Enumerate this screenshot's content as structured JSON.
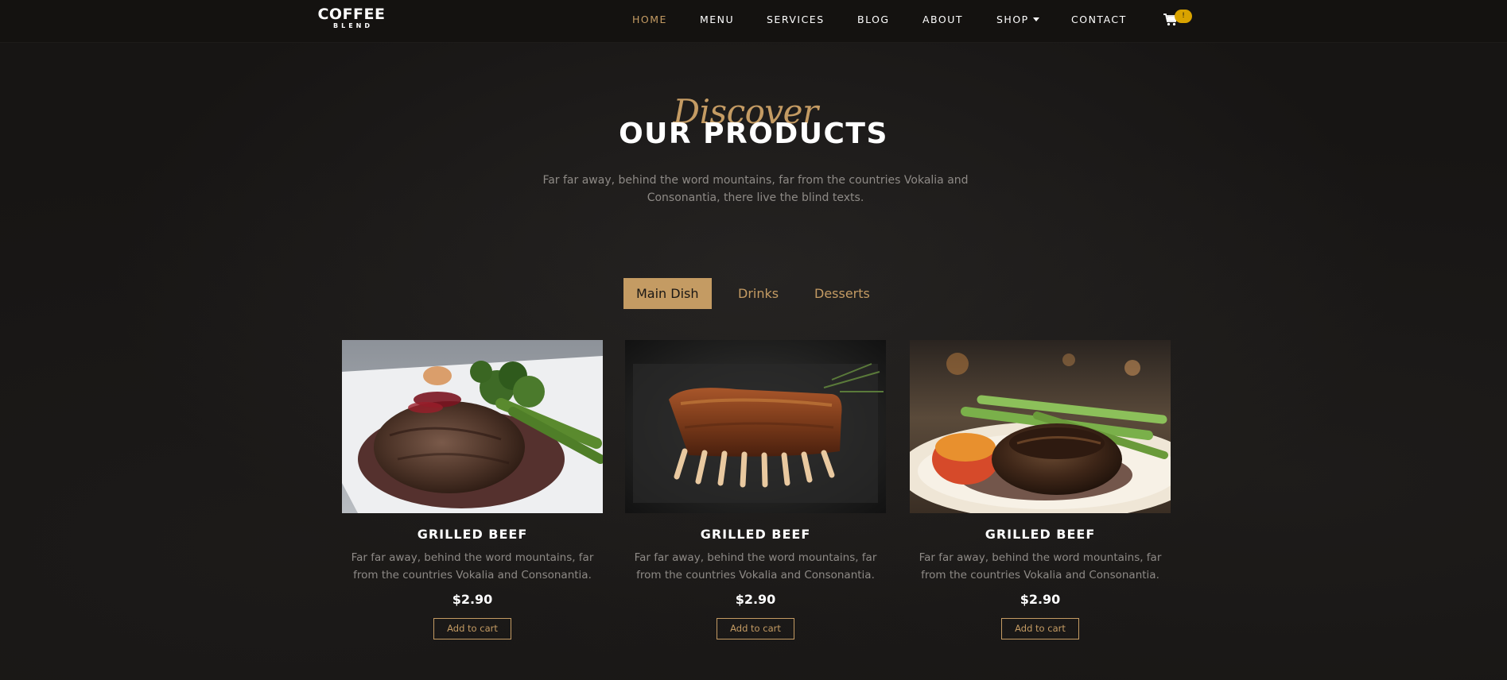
{
  "brand": {
    "main": "COFFEE",
    "sub": "BLEND"
  },
  "nav": {
    "items": [
      {
        "label": "HOME"
      },
      {
        "label": "MENU"
      },
      {
        "label": "SERVICES"
      },
      {
        "label": "BLOG"
      },
      {
        "label": "ABOUT"
      },
      {
        "label": "SHOP"
      },
      {
        "label": "CONTACT"
      }
    ],
    "cart_count": "!"
  },
  "heading": {
    "script": "Discover",
    "title": "OUR PRODUCTS",
    "intro": "Far far away, behind the word mountains, far from the countries Vokalia and Consonantia, there live the blind texts."
  },
  "tabs": [
    {
      "label": "Main Dish"
    },
    {
      "label": "Drinks"
    },
    {
      "label": "Desserts"
    }
  ],
  "products": [
    {
      "title": "GRILLED BEEF",
      "description": "Far far away, behind the word mountains, far from the countries Vokalia and Consonantia.",
      "price": "$2.90",
      "button": "Add to cart"
    },
    {
      "title": "GRILLED BEEF",
      "description": "Far far away, behind the word mountains, far from the countries Vokalia and Consonantia.",
      "price": "$2.90",
      "button": "Add to cart"
    },
    {
      "title": "GRILLED BEEF",
      "description": "Far far away, behind the word mountains, far from the countries Vokalia and Consonantia.",
      "price": "$2.90",
      "button": "Add to cart"
    }
  ],
  "colors": {
    "accent": "#c49b63",
    "badge": "#d9a300",
    "background": "#171514"
  }
}
